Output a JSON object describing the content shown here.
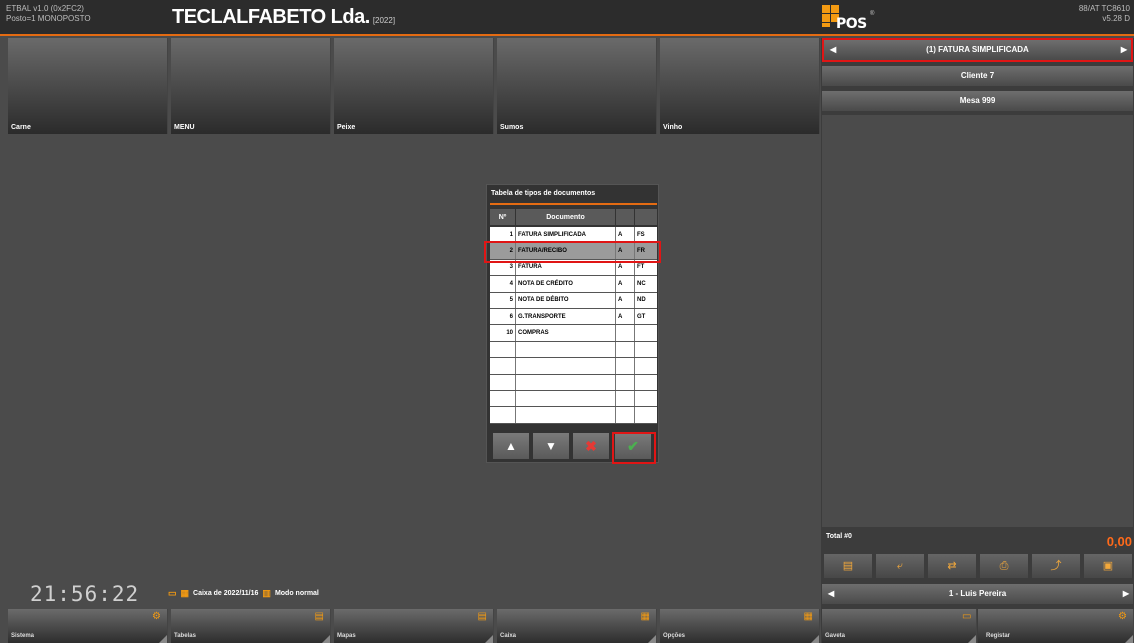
{
  "header": {
    "app_version": "ETBAL v1.0 (0x2FC2)",
    "post": "Posto=1 MONOPOSTO",
    "company": "TECLALFABETO Lda.",
    "year": "[2022]",
    "logo_text": "POS",
    "terminal_id": "88/AT TC8610",
    "terminal_version": "v5.28 D"
  },
  "families": [
    {
      "label": "Carne"
    },
    {
      "label": "MENU"
    },
    {
      "label": "Peixe"
    },
    {
      "label": "Sumos"
    },
    {
      "label": "Vinho"
    }
  ],
  "right_panel": {
    "document_type": "(1) FATURA SIMPLIFICADA",
    "client": "Cliente 7",
    "table": "Mesa 999",
    "total_label": "Total #0",
    "total_value": "0,00",
    "operator": "1 - Luis Pereira"
  },
  "status": {
    "clock": "21:56:22",
    "caixa": "Caixa de 2022/11/16",
    "mode": "Modo normal"
  },
  "bottom_buttons": [
    {
      "label": "Sistema"
    },
    {
      "label": "Tabelas"
    },
    {
      "label": "Mapas"
    },
    {
      "label": "Caixa"
    },
    {
      "label": "Opções"
    },
    {
      "label": "Gaveta"
    },
    {
      "label": "Registar"
    }
  ],
  "dialog": {
    "title": "Tabela de tipos de documentos",
    "headers": {
      "num": "Nº",
      "doc": "Documento"
    },
    "rows": [
      {
        "num": "1",
        "doc": "FATURA SIMPLIFICADA",
        "a": "A",
        "code": "FS"
      },
      {
        "num": "2",
        "doc": "FATURA/RECIBO",
        "a": "A",
        "code": "FR"
      },
      {
        "num": "3",
        "doc": "FATURA",
        "a": "A",
        "code": "FT"
      },
      {
        "num": "4",
        "doc": "NOTA DE CRÉDITO",
        "a": "A",
        "code": "NC"
      },
      {
        "num": "5",
        "doc": "NOTA DE DÉBITO",
        "a": "A",
        "code": "ND"
      },
      {
        "num": "6",
        "doc": "G.TRANSPORTE",
        "a": "A",
        "code": "GT"
      },
      {
        "num": "10",
        "doc": "COMPRAS",
        "a": "",
        "code": ""
      }
    ],
    "selected_index": 1
  },
  "colors": {
    "accent": "#e46b12",
    "highlight": "#e01515",
    "ok": "#4caf50",
    "cancel": "#e53935"
  }
}
